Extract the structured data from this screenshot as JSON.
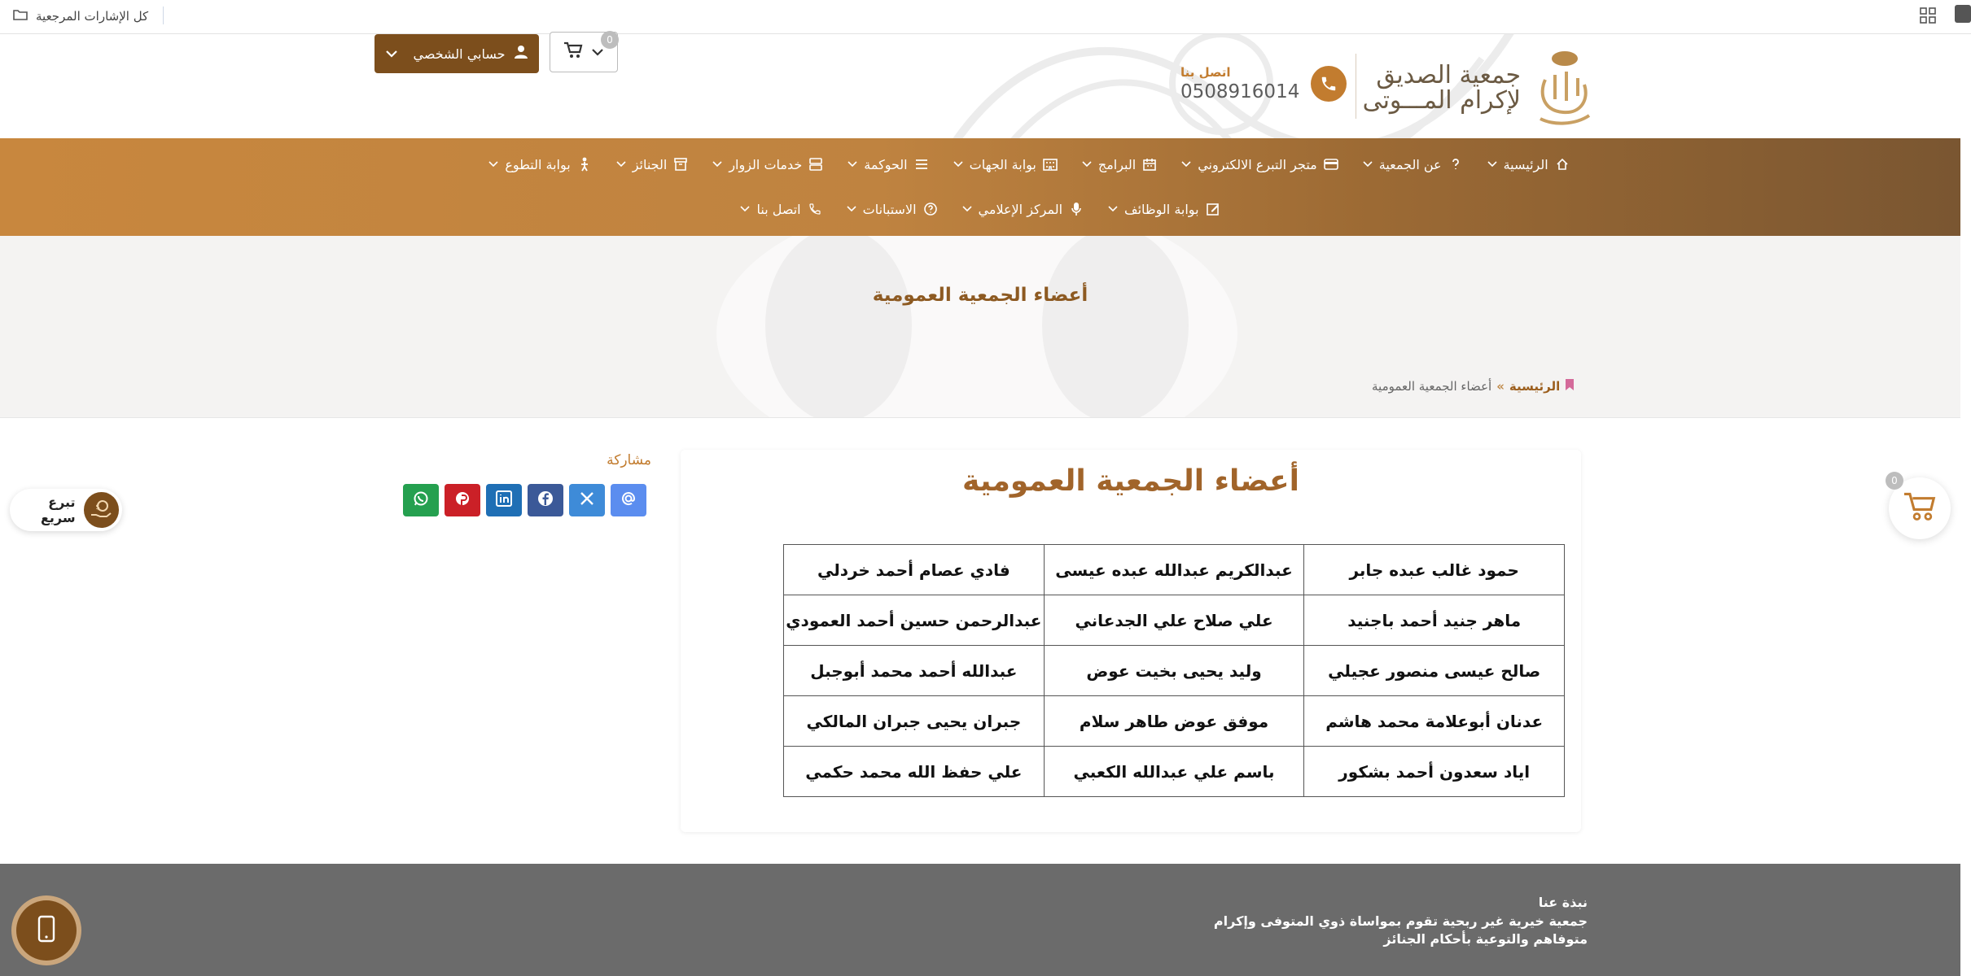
{
  "browser": {
    "bookmarks_all_label": "كل الإشارات المرجعية"
  },
  "header": {
    "logo_line1": "جمعية الصديق",
    "logo_line2": "لإكرام المـــوتى",
    "contact_label": "اتصل بنا",
    "contact_phone": "0508916014",
    "cart_count": "0",
    "account_label": "حسابي الشخصي"
  },
  "nav": {
    "row1": [
      {
        "label": "الرئيسية",
        "icon": "home-icon"
      },
      {
        "label": "عن الجمعية",
        "icon": "question-icon"
      },
      {
        "label": "متجر التبرع الالكتروني",
        "icon": "card-icon"
      },
      {
        "label": "البرامج",
        "icon": "calendar-icon"
      },
      {
        "label": "بوابة الجهات",
        "icon": "building-icon"
      },
      {
        "label": "الحوكمة",
        "icon": "list-icon"
      },
      {
        "label": "خدمات الزوار",
        "icon": "server-icon"
      },
      {
        "label": "الجنائز",
        "icon": "archive-icon"
      },
      {
        "label": "بوابة التطوع",
        "icon": "person-icon"
      }
    ],
    "row2": [
      {
        "label": "بوابة الوظائف",
        "icon": "edit-icon"
      },
      {
        "label": "المركز الإعلامي",
        "icon": "mic-icon"
      },
      {
        "label": "الاستبانات",
        "icon": "help-circle-icon"
      },
      {
        "label": "اتصل بنا",
        "icon": "phone-icon"
      }
    ]
  },
  "hero": {
    "title": "أعضاء الجمعية العمومية",
    "breadcrumb_home": "الرئيسية",
    "breadcrumb_sep": "»",
    "breadcrumb_current": "أعضاء الجمعية العمومية"
  },
  "content": {
    "title": "أعضاء الجمعية العمومية",
    "members": [
      [
        "حمود غالب عبده جابر",
        "عبدالكريم عبدالله عبده عيسى",
        "فادي عصام أحمد خردلي"
      ],
      [
        "ماهر جنيد أحمد باجنيد",
        "علي صلاح علي الجدعاني",
        "عبدالرحمن حسين أحمد العمودي"
      ],
      [
        "صالح عيسى منصور عجيلي",
        "وليد يحيى بخيت عوض",
        "عبدالله أحمد محمد أبوجبل"
      ],
      [
        "عدنان أبوعلامة محمد هاشم",
        "موفق عوض طاهر سلام",
        "جبران يحيى جبران المالكي"
      ],
      [
        "اياد سعدون أحمد بشكور",
        "باسم علي عبدالله الكعبي",
        "علي حفظ الله محمد حكمي"
      ]
    ]
  },
  "share": {
    "label": "مشاركة",
    "buttons": [
      {
        "name": "email",
        "icon": "at-icon",
        "color": "#5b8def"
      },
      {
        "name": "x",
        "icon": "x-icon",
        "color": "#3e8bd8"
      },
      {
        "name": "facebook",
        "icon": "facebook-icon",
        "color": "#3b5998"
      },
      {
        "name": "linkedin",
        "icon": "linkedin-icon",
        "color": "#1f6fb5"
      },
      {
        "name": "pinterest",
        "icon": "pinterest-icon",
        "color": "#cb2027"
      },
      {
        "name": "whatsapp",
        "icon": "whatsapp-icon",
        "color": "#25a04f"
      }
    ]
  },
  "quick_donate": {
    "label": "تبرع سريع"
  },
  "float_cart": {
    "count": "0"
  },
  "footer": {
    "about_title": "نبذة عنا",
    "about_text": "جمعية خيرية غير ربحية تقوم بمواساة ذوي المتوفى وإكرام متوفاهم والتوعية بأحكام الجنائز"
  },
  "colors": {
    "brand_brown": "#7c4e1c",
    "brand_orange": "#c27c2f",
    "title_brown": "#a1642a"
  }
}
